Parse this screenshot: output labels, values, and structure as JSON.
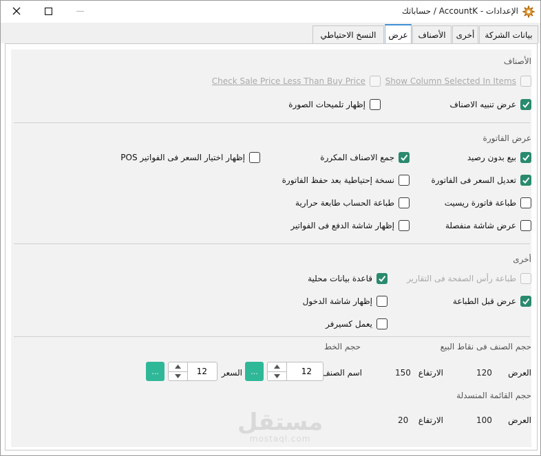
{
  "window": {
    "title": "الإعدادات - AccountK / حساباتك",
    "icon": "gear-icon",
    "controls": [
      "minimize-icon",
      "maximize-icon",
      "close-icon"
    ]
  },
  "tabs": [
    {
      "label": "بيانات الشركة",
      "active": false
    },
    {
      "label": "أخرى",
      "active": false
    },
    {
      "label": "الأصناف",
      "active": false
    },
    {
      "label": "عرض",
      "active": true
    },
    {
      "label": "النسخ الاحتياطي",
      "active": false
    }
  ],
  "sections": {
    "items": {
      "title": "الأصناف",
      "show_column_selected": {
        "label": "Show Column Selected In Items",
        "checked": false,
        "enabled": false
      },
      "check_sale_price": {
        "label": "Check Sale Price Less Than Buy Price",
        "checked": false,
        "enabled": false
      },
      "show_items_alert": {
        "label": "عرض تنبيه الاصناف",
        "checked": true
      },
      "show_image_tips": {
        "label": "إظهار تلميحات الصورة",
        "checked": false
      }
    },
    "invoice": {
      "title": "عرض الفاتورة",
      "sell_without_balance": {
        "label": "بيع بدون رصيد",
        "checked": true
      },
      "merge_repeated_items": {
        "label": "جمع الاصناف المكررة",
        "checked": true
      },
      "show_price_choice_pos": {
        "label": "إظهار اختيار السعر فى الفواتير POS",
        "checked": false
      },
      "edit_price_in_invoice": {
        "label": "تعديل السعر فى الفاتورة",
        "checked": true
      },
      "backup_after_save": {
        "label": "نسخة إحتياطية بعد حفظ الفاتورة",
        "checked": false
      },
      "print_receipt": {
        "label": "طباعة فاتورة ريسيت",
        "checked": false
      },
      "print_thermal_account": {
        "label": "طباعة الحساب طابعة حرارية",
        "checked": false
      },
      "separate_screen": {
        "label": "عرض شاشة منفصلة",
        "checked": false
      },
      "show_payment_screen": {
        "label": "إظهار شاشة الدفع فى الفواتير",
        "checked": false
      }
    },
    "other": {
      "title": "أخرى",
      "print_report_header": {
        "label": "طباعة رأس الصفحة فى التقارير",
        "checked": false,
        "enabled": false
      },
      "local_database": {
        "label": "قاعدة بيانات محلية",
        "checked": true
      },
      "preview_before_print": {
        "label": "عرض قبل الطباعة",
        "checked": true
      },
      "show_login_screen": {
        "label": "إظهار شاشة الدخول",
        "checked": false
      },
      "works_as_server": {
        "label": "يعمل كسيرفر",
        "checked": false
      }
    },
    "sizes": {
      "pos_item_size_title": "حجم الصنف فى نقاط البيع",
      "font_size_title": "حجم الخط",
      "width_label": "العرض",
      "height_label": "الارتفاع",
      "pos_width": "120",
      "pos_height": "150",
      "item_name_label": "اسم الصنف",
      "item_name_font": "12",
      "price_label": "السعر",
      "price_font": "12",
      "dots_label": "...",
      "dropdown_title": "حجم القائمة المنسدلة",
      "dropdown_width": "100",
      "dropdown_height": "20"
    }
  },
  "watermark": {
    "arabic": "مستقل",
    "latin": "mostaql.com"
  },
  "colors": {
    "accent": "#2a8a6e",
    "button": "#2fb898",
    "tab_active_border": "#3c8fd6"
  }
}
